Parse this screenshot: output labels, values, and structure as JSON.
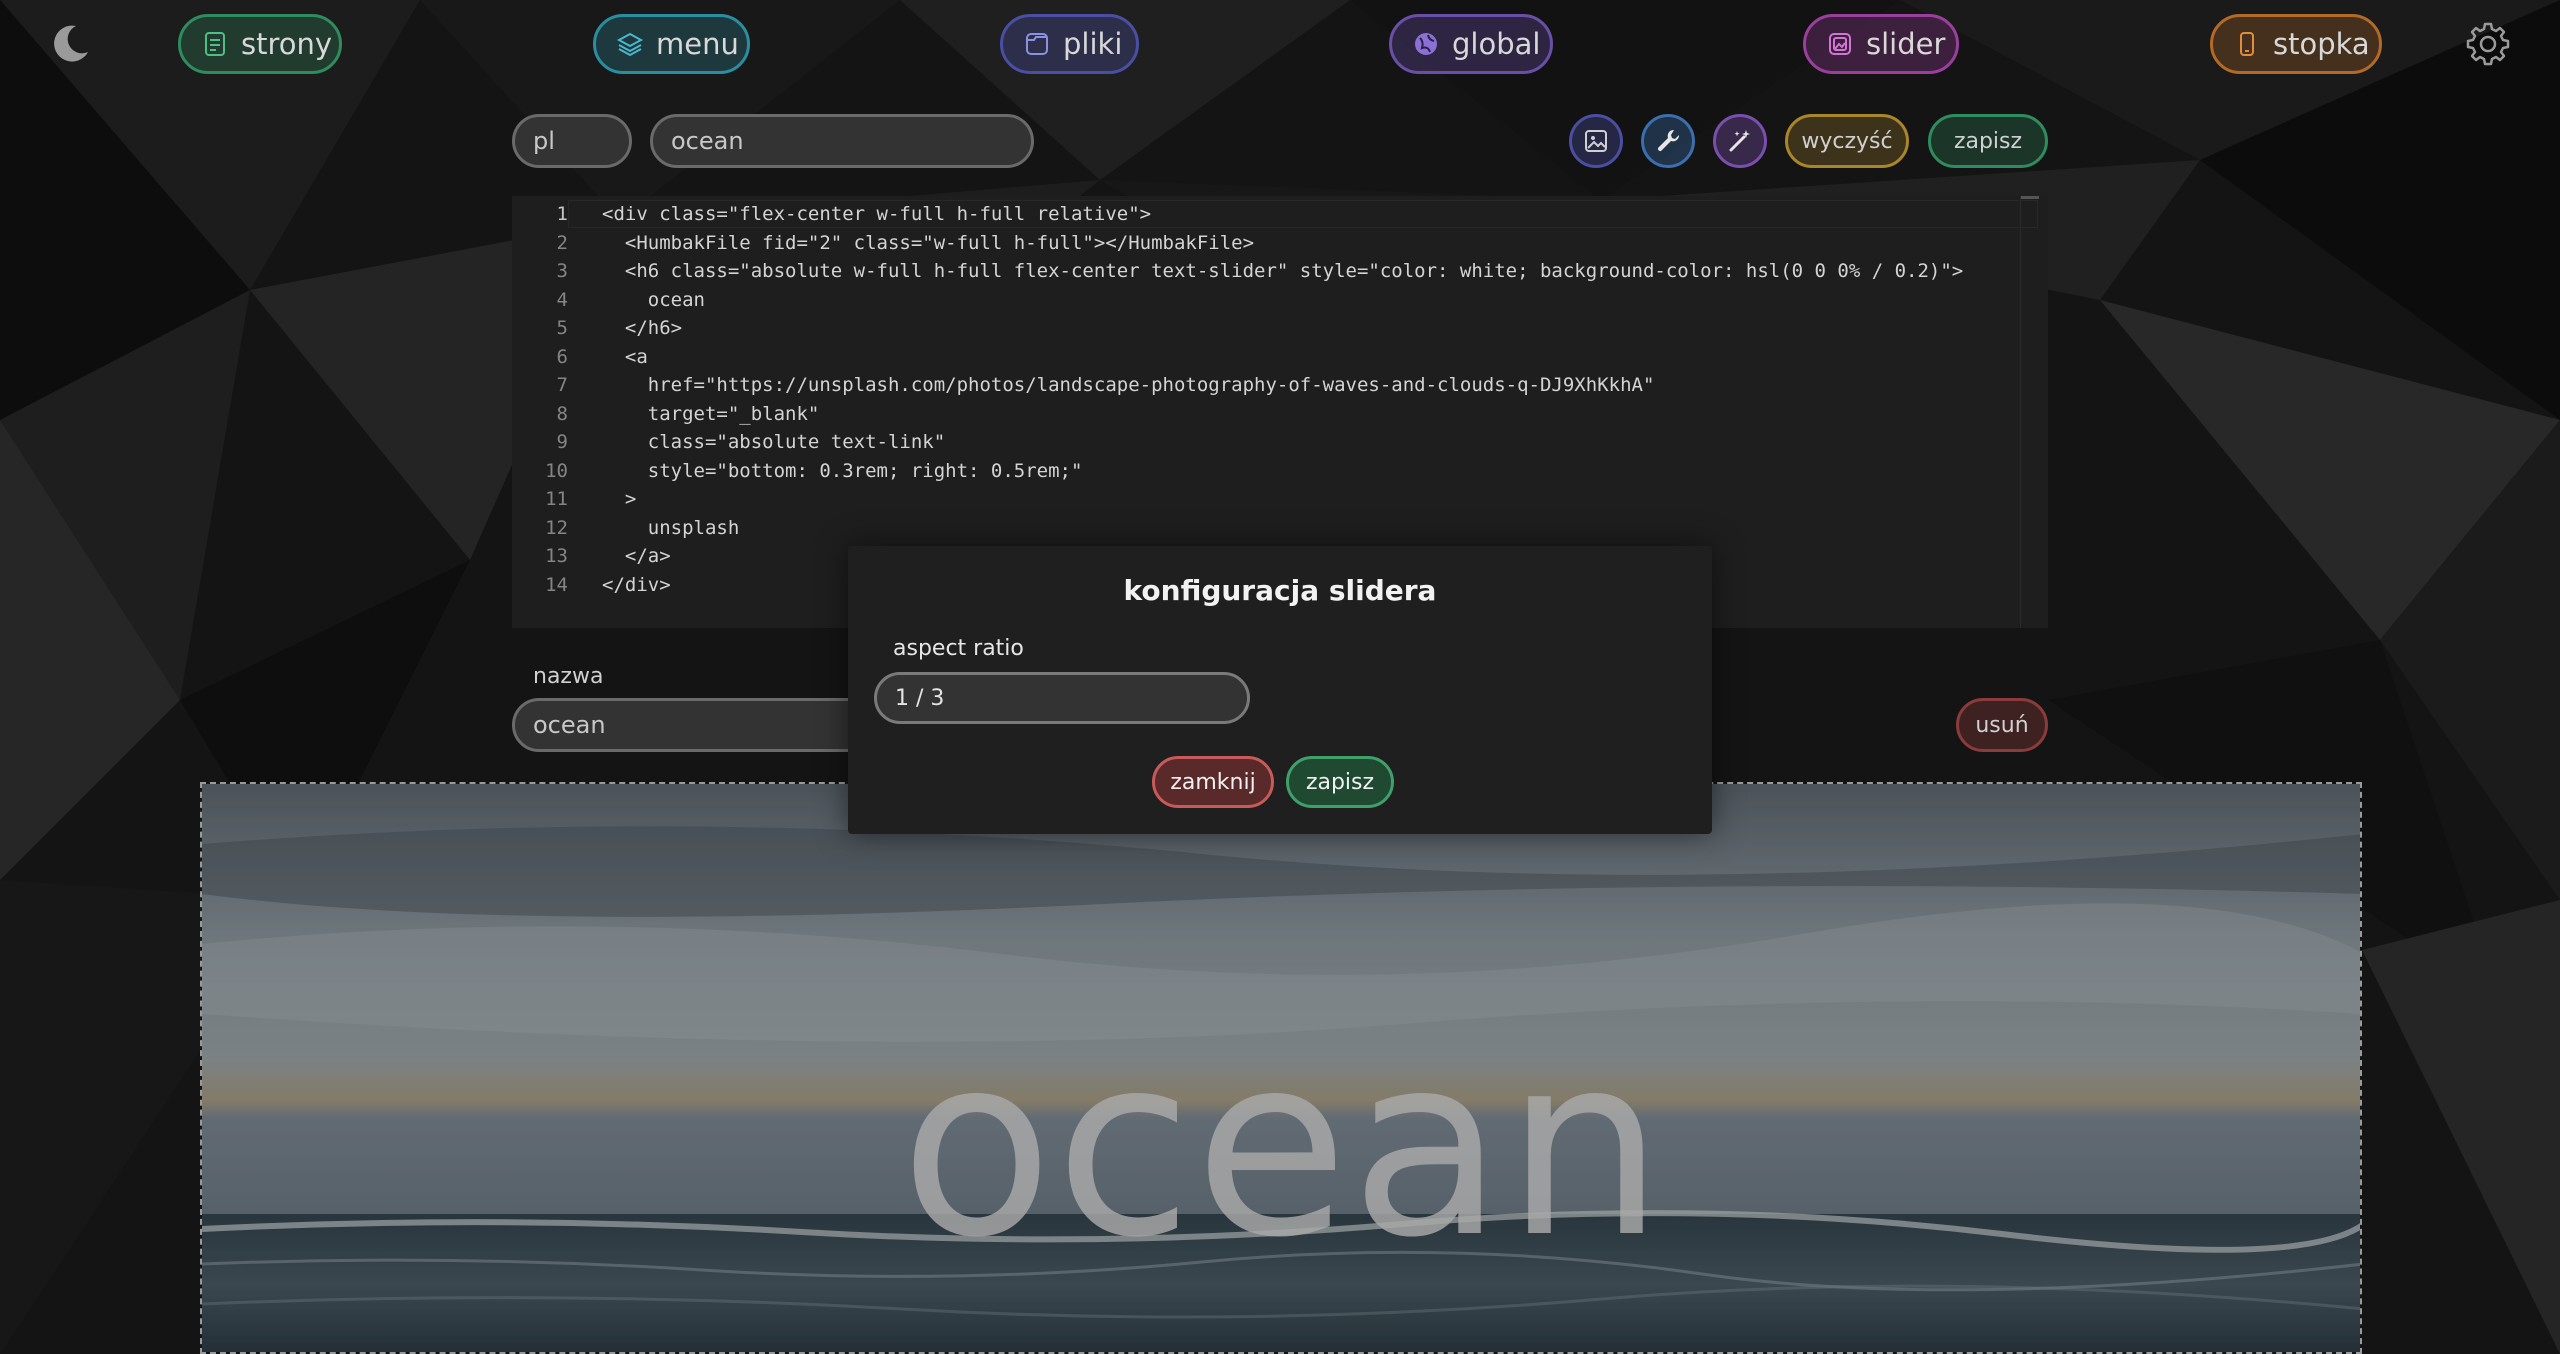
{
  "nav": {
    "items": [
      {
        "label": "strony",
        "icon": "document-icon",
        "color": "#2f8c5e"
      },
      {
        "label": "menu",
        "icon": "layers-icon",
        "color": "#2a8ea0"
      },
      {
        "label": "pliki",
        "icon": "folder-icon",
        "color": "#4a4fa3"
      },
      {
        "label": "global",
        "icon": "globe-icon",
        "color": "#6a4fa8"
      },
      {
        "label": "slider",
        "icon": "image-stack-icon",
        "color": "#9a3f9e"
      },
      {
        "label": "stopka",
        "icon": "phone-icon",
        "color": "#b36a26"
      }
    ],
    "theme_icon": "moon-icon",
    "settings_icon": "gear-icon"
  },
  "toolbar": {
    "language": "pl",
    "slide_title": "ocean",
    "image_button_icon": "image-icon",
    "config_button_icon": "wrench-icon",
    "magic_button_icon": "magic-wand-icon",
    "clear_label": "wyczyść",
    "save_label": "zapisz"
  },
  "editor": {
    "line_numbers": [
      "1",
      "2",
      "3",
      "4",
      "5",
      "6",
      "7",
      "8",
      "9",
      "10",
      "11",
      "12",
      "13",
      "14"
    ],
    "lines": [
      "<div class=\"flex-center w-full h-full relative\">",
      "  <HumbakFile fid=\"2\" class=\"w-full h-full\"></HumbakFile>",
      "  <h6 class=\"absolute w-full h-full flex-center text-slider\" style=\"color: white; background-color: hsl(0 0 0% / 0.2)\">",
      "    ocean",
      "  </h6>",
      "  <a",
      "    href=\"https://unsplash.com/photos/landscape-photography-of-waves-and-clouds-q-DJ9XhKkhA\"",
      "    target=\"_blank\"",
      "    class=\"absolute text-link\"",
      "    style=\"bottom: 0.3rem; right: 0.5rem;\"",
      "  >",
      "    unsplash",
      "  </a>",
      "</div>"
    ]
  },
  "name_section": {
    "label": "nazwa",
    "value": "ocean",
    "delete_label": "usuń"
  },
  "preview": {
    "text": "ocean"
  },
  "modal": {
    "title": "konfiguracja slidera",
    "aspect_label": "aspect ratio",
    "aspect_value": "1 / 3",
    "close_label": "zamknij",
    "save_label": "zapisz"
  }
}
